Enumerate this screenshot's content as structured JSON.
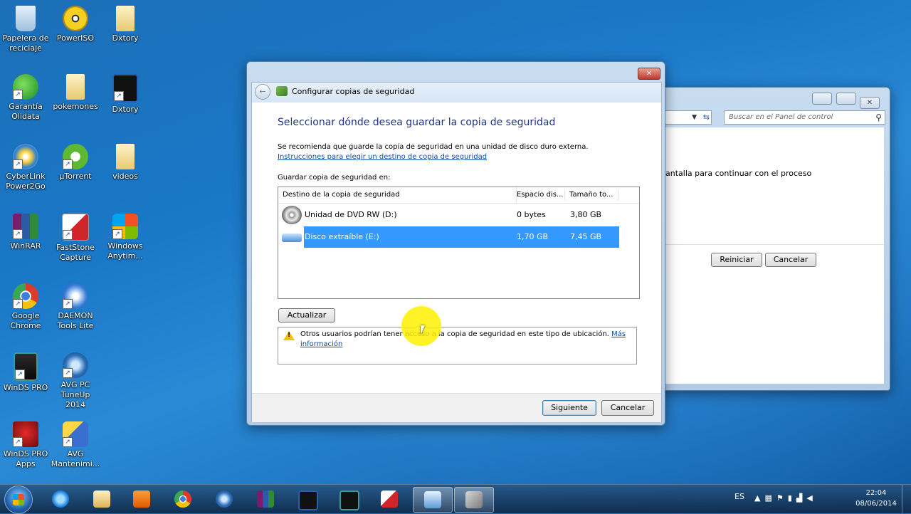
{
  "desktop": {
    "icons": [
      {
        "label": "Papelera de reciclaje",
        "icon": "recycle-bin-icon"
      },
      {
        "label": "PowerISO",
        "icon": "poweriso-icon"
      },
      {
        "label": "Dxtory",
        "icon": "folder-icon"
      },
      {
        "label": "Garantía Olidata",
        "icon": "olidata-icon"
      },
      {
        "label": "pokemones",
        "icon": "folder-icon"
      },
      {
        "label": "Dxtory",
        "icon": "dxtory-icon"
      },
      {
        "label": "CyberLink Power2Go",
        "icon": "power2go-icon"
      },
      {
        "label": "µTorrent",
        "icon": "utorrent-icon"
      },
      {
        "label": "videos",
        "icon": "folder-icon"
      },
      {
        "label": "WinRAR",
        "icon": "winrar-icon"
      },
      {
        "label": "FastStone Capture",
        "icon": "faststone-icon"
      },
      {
        "label": "Windows Anytim...",
        "icon": "windows-anytime-icon"
      },
      {
        "label": "Google Chrome",
        "icon": "chrome-icon"
      },
      {
        "label": "DAEMON Tools Lite",
        "icon": "daemon-tools-icon"
      },
      {
        "label": "WinDS PRO",
        "icon": "winds-pro-icon"
      },
      {
        "label": "AVG PC TuneUp 2014",
        "icon": "avg-tuneup-icon"
      },
      {
        "label": "WinDS PRO Apps",
        "icon": "winds-apps-icon"
      },
      {
        "label": "AVG Mantenimi...",
        "icon": "avg-maint-icon"
      }
    ]
  },
  "control_panel": {
    "search_placeholder": "Buscar en el Panel de control",
    "body_text": "antalla para continuar con el proceso",
    "restart_label": "Reiniciar",
    "cancel_label": "Cancelar"
  },
  "dialog": {
    "title": "Configurar copias de seguridad",
    "heading": "Seleccionar dónde desea guardar la copia de seguridad",
    "recommendation": "Se recomienda que guarde la copia de seguridad en una unidad de disco duro externa.",
    "recommendation_link": "Instrucciones para elegir un destino de copia de seguridad",
    "save_in_label": "Guardar copia de seguridad en:",
    "columns": [
      "Destino de la copia de seguridad",
      "Espacio dis...",
      "Tamaño to..."
    ],
    "rows": [
      {
        "destination": "Unidad de DVD RW (D:)",
        "free": "0 bytes",
        "total": "3,80 GB",
        "selected": false
      },
      {
        "destination": "Disco extraíble (E:)",
        "free": "1,70 GB",
        "total": "7,45 GB",
        "selected": true
      }
    ],
    "refresh_label": "Actualizar",
    "warning_text": "Otros usuarios podrían tener acceso a la copia de seguridad en este tipo de ubicación.",
    "warning_link": "Más información",
    "next_label": "Siguiente",
    "cancel_label": "Cancelar"
  },
  "taskbar": {
    "language": "ES",
    "time": "22:04",
    "date": "08/06/2014"
  },
  "colors": {
    "selection": "#3399ff",
    "heading": "#1e3287",
    "link": "#0b4fb0"
  }
}
